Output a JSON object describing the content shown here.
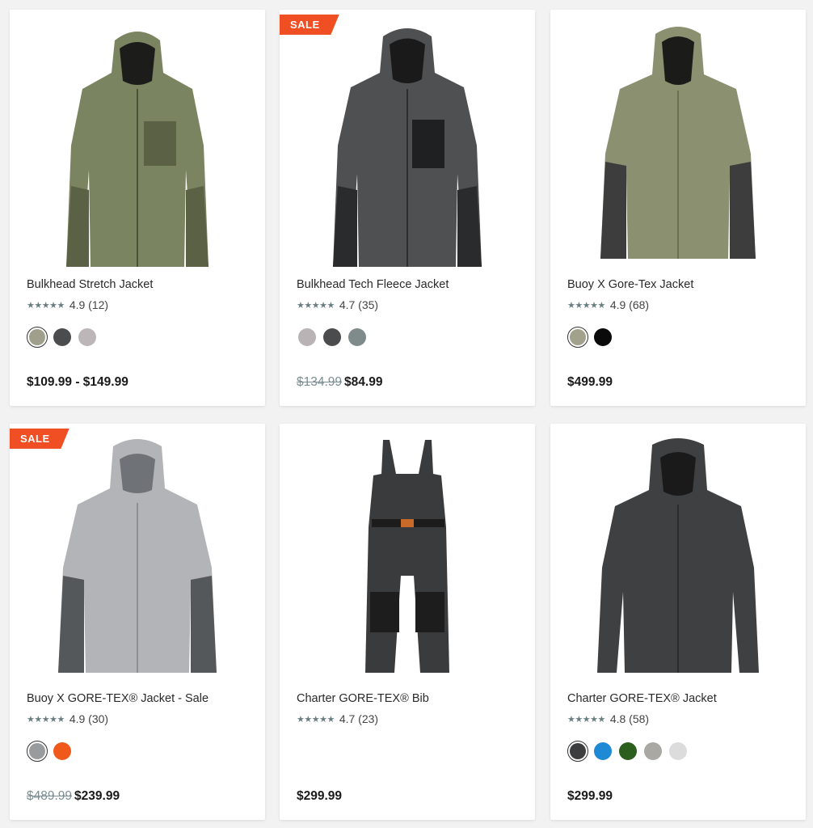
{
  "products": [
    {
      "name": "Bulkhead Stretch Jacket",
      "stars": "★★★★★",
      "rating": "4.9",
      "reviews": "(12)",
      "badge": "",
      "was_price": "",
      "price": "$109.99 - $149.99",
      "swatches": [
        "#a09f8c",
        "#4b4c4d",
        "#bdb6b9"
      ],
      "selected_swatch": 0
    },
    {
      "name": "Bulkhead Tech Fleece Jacket",
      "stars": "★★★★★",
      "rating": "4.7",
      "reviews": "(35)",
      "badge": "SALE",
      "was_price": "$134.99",
      "price": "$84.99",
      "swatches": [
        "#b9b3b5",
        "#4b4c4d",
        "#7e8b8a"
      ],
      "selected_swatch": -1
    },
    {
      "name": "Buoy X Gore-Tex Jacket",
      "stars": "★★★★★",
      "rating": "4.9",
      "reviews": "(68)",
      "badge": "",
      "was_price": "",
      "price": "$499.99",
      "swatches": [
        "#a2a28c",
        "#0a0a0a"
      ],
      "selected_swatch": 0
    },
    {
      "name": "Buoy X GORE-TEX® Jacket - Sale",
      "stars": "★★★★★",
      "rating": "4.9",
      "reviews": "(30)",
      "badge": "SALE",
      "was_price": "$489.99",
      "price": "$239.99",
      "swatches": [
        "#9a9b9d",
        "#f0581c"
      ],
      "selected_swatch": 0
    },
    {
      "name": "Charter GORE-TEX® Bib",
      "stars": "★★★★★",
      "rating": "4.7",
      "reviews": "(23)",
      "badge": "",
      "was_price": "",
      "price": "$299.99",
      "swatches": [],
      "selected_swatch": -1
    },
    {
      "name": "Charter GORE-TEX® Jacket",
      "stars": "★★★★★",
      "rating": "4.8",
      "reviews": "(58)",
      "badge": "",
      "was_price": "",
      "price": "$299.99",
      "swatches": [
        "#3d3e40",
        "#1e8ad6",
        "#2c5e1e",
        "#a9a8a3",
        "#dcdcdc"
      ],
      "selected_swatch": 0
    }
  ]
}
